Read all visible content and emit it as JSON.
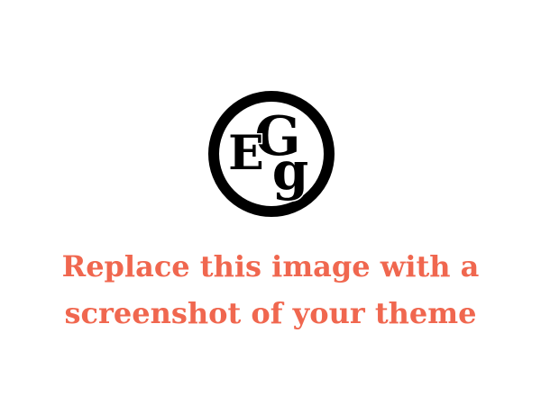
{
  "logo": {
    "icon": "eg-monogram-logo",
    "letters": [
      "E",
      "G",
      "g"
    ],
    "color": "#000000"
  },
  "placeholder": {
    "line1": "Replace this image with a",
    "line2": "screenshot of your theme",
    "color": "#f0674f"
  },
  "background": "#ffffff"
}
